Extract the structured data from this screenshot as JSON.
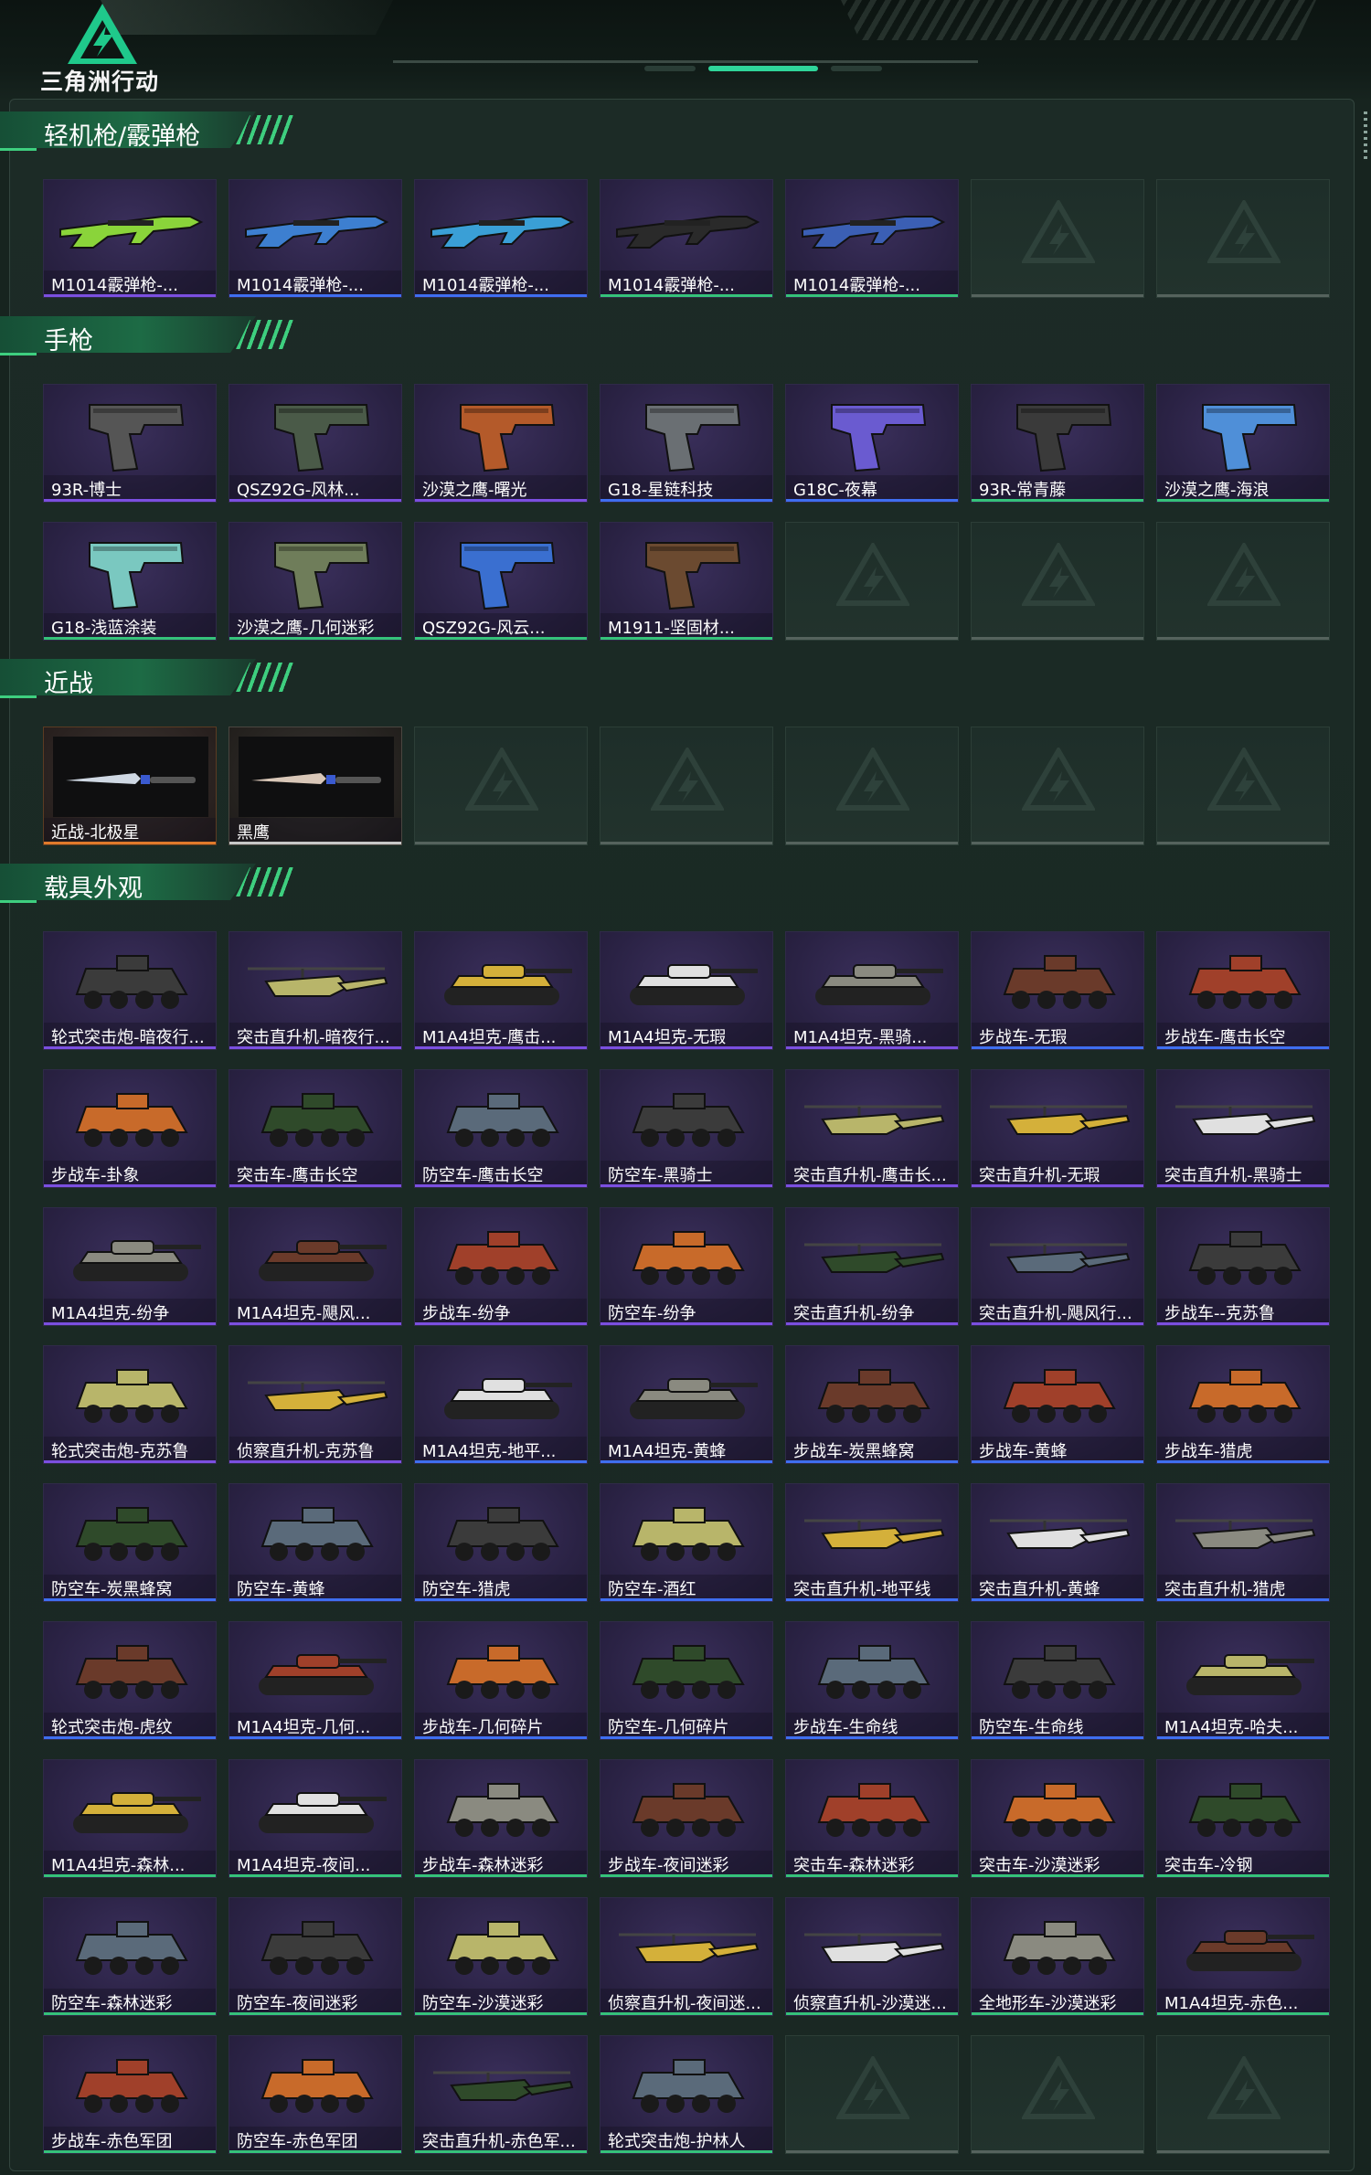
{
  "app": {
    "logo_text": "三角洲行动"
  },
  "colors": {
    "accent_green": "#3ecf7f",
    "purple_rarity": "#7b4fe0",
    "blue_rarity": "#3f6ef0",
    "orange_rarity": "#e07a2b",
    "green_rarity": "#35c27a"
  },
  "sections": [
    {
      "title": "轻机枪/霰弹枪",
      "kind": "gun",
      "items": [
        {
          "label": "M1014霰弹枪-...",
          "rarity": "purple"
        },
        {
          "label": "M1014霰弹枪-...",
          "rarity": "blue"
        },
        {
          "label": "M1014霰弹枪-...",
          "rarity": "blue"
        },
        {
          "label": "M1014霰弹枪-...",
          "rarity": "green"
        },
        {
          "label": "M1014霰弹枪-...",
          "rarity": "green"
        },
        {
          "label": "",
          "rarity": "empty"
        },
        {
          "label": "",
          "rarity": "empty"
        }
      ]
    },
    {
      "title": "手枪",
      "kind": "pistol",
      "items": [
        {
          "label": "93R-博士",
          "rarity": "purple"
        },
        {
          "label": "QSZ92G-风林...",
          "rarity": "purple"
        },
        {
          "label": "沙漠之鹰-曙光",
          "rarity": "purple"
        },
        {
          "label": "G18-星链科技",
          "rarity": "blue"
        },
        {
          "label": "G18C-夜幕",
          "rarity": "blue"
        },
        {
          "label": "93R-常青藤",
          "rarity": "green"
        },
        {
          "label": "沙漠之鹰-海浪",
          "rarity": "green"
        },
        {
          "label": "G18-浅蓝涂装",
          "rarity": "green"
        },
        {
          "label": "沙漠之鹰-几何迷彩",
          "rarity": "green"
        },
        {
          "label": "QSZ92G-风云...",
          "rarity": "green"
        },
        {
          "label": "M1911-坚固材...",
          "rarity": "green"
        },
        {
          "label": "",
          "rarity": "empty"
        },
        {
          "label": "",
          "rarity": "empty"
        },
        {
          "label": "",
          "rarity": "empty"
        }
      ]
    },
    {
      "title": "近战",
      "kind": "knife",
      "items": [
        {
          "label": "近战-北极星",
          "rarity": "orange"
        },
        {
          "label": "黑鹰",
          "rarity": "white"
        },
        {
          "label": "",
          "rarity": "empty"
        },
        {
          "label": "",
          "rarity": "empty"
        },
        {
          "label": "",
          "rarity": "empty"
        },
        {
          "label": "",
          "rarity": "empty"
        },
        {
          "label": "",
          "rarity": "empty"
        }
      ]
    },
    {
      "title": "载具外观",
      "kind": "vehicle",
      "items": [
        {
          "label": "轮式突击炮-暗夜行...",
          "rarity": "purple"
        },
        {
          "label": "突击直升机-暗夜行...",
          "rarity": "purple"
        },
        {
          "label": "M1A4坦克-鹰击...",
          "rarity": "purple"
        },
        {
          "label": "M1A4坦克-无瑕",
          "rarity": "purple"
        },
        {
          "label": "M1A4坦克-黑骑...",
          "rarity": "purple"
        },
        {
          "label": "步战车-无瑕",
          "rarity": "blue"
        },
        {
          "label": "步战车-鹰击长空",
          "rarity": "blue"
        },
        {
          "label": "步战车-卦象",
          "rarity": "purple"
        },
        {
          "label": "突击车-鹰击长空",
          "rarity": "purple"
        },
        {
          "label": "防空车-鹰击长空",
          "rarity": "purple"
        },
        {
          "label": "防空车-黑骑士",
          "rarity": "purple"
        },
        {
          "label": "突击直升机-鹰击长...",
          "rarity": "purple"
        },
        {
          "label": "突击直升机-无瑕",
          "rarity": "purple"
        },
        {
          "label": "突击直升机-黑骑士",
          "rarity": "purple"
        },
        {
          "label": "M1A4坦克-纷争",
          "rarity": "purple"
        },
        {
          "label": "M1A4坦克-飓风...",
          "rarity": "purple"
        },
        {
          "label": "步战车-纷争",
          "rarity": "purple"
        },
        {
          "label": "防空车-纷争",
          "rarity": "purple"
        },
        {
          "label": "突击直升机-纷争",
          "rarity": "purple"
        },
        {
          "label": "突击直升机-飓风行...",
          "rarity": "purple"
        },
        {
          "label": "步战车--克苏鲁",
          "rarity": "purple"
        },
        {
          "label": "轮式突击炮-克苏鲁",
          "rarity": "purple"
        },
        {
          "label": "侦察直升机-克苏鲁",
          "rarity": "purple"
        },
        {
          "label": "M1A4坦克-地平...",
          "rarity": "blue"
        },
        {
          "label": "M1A4坦克-黄蜂",
          "rarity": "blue"
        },
        {
          "label": "步战车-炭黑蜂窝",
          "rarity": "blue"
        },
        {
          "label": "步战车-黄蜂",
          "rarity": "blue"
        },
        {
          "label": "步战车-猎虎",
          "rarity": "blue"
        },
        {
          "label": "防空车-炭黑蜂窝",
          "rarity": "blue"
        },
        {
          "label": "防空车-黄蜂",
          "rarity": "blue"
        },
        {
          "label": "防空车-猎虎",
          "rarity": "blue"
        },
        {
          "label": "防空车-酒红",
          "rarity": "blue"
        },
        {
          "label": "突击直升机-地平线",
          "rarity": "blue"
        },
        {
          "label": "突击直升机-黄蜂",
          "rarity": "blue"
        },
        {
          "label": "突击直升机-猎虎",
          "rarity": "blue"
        },
        {
          "label": "轮式突击炮-虎纹",
          "rarity": "blue"
        },
        {
          "label": "M1A4坦克-几何...",
          "rarity": "blue"
        },
        {
          "label": "步战车-几何碎片",
          "rarity": "blue"
        },
        {
          "label": "防空车-几何碎片",
          "rarity": "blue"
        },
        {
          "label": "步战车-生命线",
          "rarity": "blue"
        },
        {
          "label": "防空车-生命线",
          "rarity": "blue"
        },
        {
          "label": "M1A4坦克-哈夫...",
          "rarity": "blue"
        },
        {
          "label": "M1A4坦克-森林...",
          "rarity": "green"
        },
        {
          "label": "M1A4坦克-夜间...",
          "rarity": "green"
        },
        {
          "label": "步战车-森林迷彩",
          "rarity": "green"
        },
        {
          "label": "步战车-夜间迷彩",
          "rarity": "green"
        },
        {
          "label": "突击车-森林迷彩",
          "rarity": "green"
        },
        {
          "label": "突击车-沙漠迷彩",
          "rarity": "green"
        },
        {
          "label": "突击车-冷钢",
          "rarity": "green"
        },
        {
          "label": "防空车-森林迷彩",
          "rarity": "green"
        },
        {
          "label": "防空车-夜间迷彩",
          "rarity": "green"
        },
        {
          "label": "防空车-沙漠迷彩",
          "rarity": "green"
        },
        {
          "label": "侦察直升机-夜间迷...",
          "rarity": "green"
        },
        {
          "label": "侦察直升机-沙漠迷...",
          "rarity": "green"
        },
        {
          "label": "全地形车-沙漠迷彩",
          "rarity": "green"
        },
        {
          "label": "M1A4坦克-赤色...",
          "rarity": "green"
        },
        {
          "label": "步战车-赤色军团",
          "rarity": "green"
        },
        {
          "label": "防空车-赤色军团",
          "rarity": "green"
        },
        {
          "label": "突击直升机-赤色军...",
          "rarity": "green"
        },
        {
          "label": "轮式突击炮-护林人",
          "rarity": "green"
        },
        {
          "label": "",
          "rarity": "empty"
        },
        {
          "label": "",
          "rarity": "empty"
        },
        {
          "label": "",
          "rarity": "empty"
        }
      ]
    }
  ]
}
